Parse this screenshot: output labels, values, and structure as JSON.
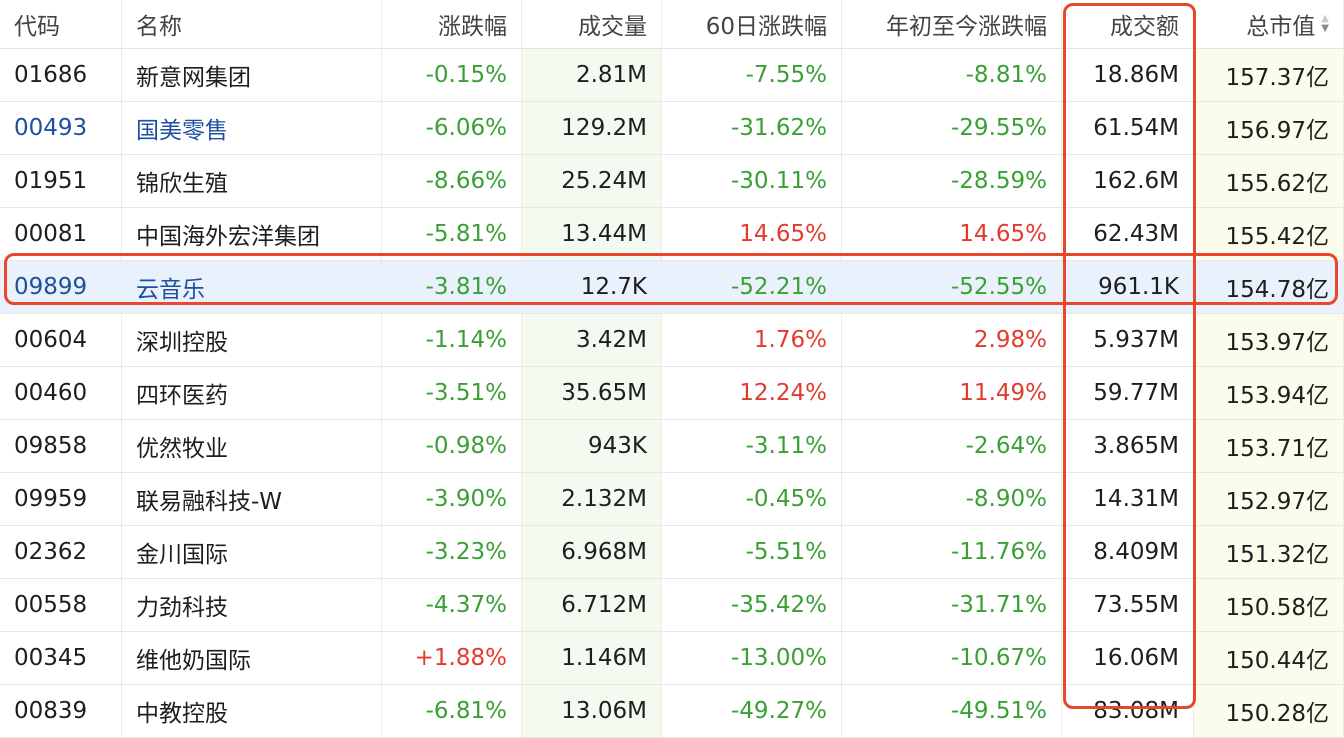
{
  "headers": {
    "code": "代码",
    "name": "名称",
    "change": "涨跌幅",
    "volume": "成交量",
    "change60": "60日涨跌幅",
    "ytd": "年初至今涨跌幅",
    "turnover": "成交额",
    "mktcap": "总市值"
  },
  "colors": {
    "up": "#e23b2e",
    "down": "#3a9f34",
    "link": "#1e4fa0",
    "highlight_box": "#e8472b"
  },
  "rows": [
    {
      "code": "01686",
      "name": "新意网集团",
      "change": "-0.15%",
      "volume": "2.81M",
      "change60": "-7.55%",
      "ytd": "-8.81%",
      "turnover": "18.86M",
      "mktcap": "157.37亿",
      "link": false
    },
    {
      "code": "00493",
      "name": "国美零售",
      "change": "-6.06%",
      "volume": "129.2M",
      "change60": "-31.62%",
      "ytd": "-29.55%",
      "turnover": "61.54M",
      "mktcap": "156.97亿",
      "link": true
    },
    {
      "code": "01951",
      "name": "锦欣生殖",
      "change": "-8.66%",
      "volume": "25.24M",
      "change60": "-30.11%",
      "ytd": "-28.59%",
      "turnover": "162.6M",
      "mktcap": "155.62亿",
      "link": false
    },
    {
      "code": "00081",
      "name": "中国海外宏洋集团",
      "change": "-5.81%",
      "volume": "13.44M",
      "change60": "14.65%",
      "ytd": "14.65%",
      "turnover": "62.43M",
      "mktcap": "155.42亿",
      "link": false
    },
    {
      "code": "09899",
      "name": "云音乐",
      "change": "-3.81%",
      "volume": "12.7K",
      "change60": "-52.21%",
      "ytd": "-52.55%",
      "turnover": "961.1K",
      "mktcap": "154.78亿",
      "link": true
    },
    {
      "code": "00604",
      "name": "深圳控股",
      "change": "-1.14%",
      "volume": "3.42M",
      "change60": "1.76%",
      "ytd": "2.98%",
      "turnover": "5.937M",
      "mktcap": "153.97亿",
      "link": false
    },
    {
      "code": "00460",
      "name": "四环医药",
      "change": "-3.51%",
      "volume": "35.65M",
      "change60": "12.24%",
      "ytd": "11.49%",
      "turnover": "59.77M",
      "mktcap": "153.94亿",
      "link": false
    },
    {
      "code": "09858",
      "name": "优然牧业",
      "change": "-0.98%",
      "volume": "943K",
      "change60": "-3.11%",
      "ytd": "-2.64%",
      "turnover": "3.865M",
      "mktcap": "153.71亿",
      "link": false
    },
    {
      "code": "09959",
      "name": "联易融科技-W",
      "change": "-3.90%",
      "volume": "2.132M",
      "change60": "-0.45%",
      "ytd": "-8.90%",
      "turnover": "14.31M",
      "mktcap": "152.97亿",
      "link": false
    },
    {
      "code": "02362",
      "name": "金川国际",
      "change": "-3.23%",
      "volume": "6.968M",
      "change60": "-5.51%",
      "ytd": "-11.76%",
      "turnover": "8.409M",
      "mktcap": "151.32亿",
      "link": false
    },
    {
      "code": "00558",
      "name": "力劲科技",
      "change": "-4.37%",
      "volume": "6.712M",
      "change60": "-35.42%",
      "ytd": "-31.71%",
      "turnover": "73.55M",
      "mktcap": "150.58亿",
      "link": false
    },
    {
      "code": "00345",
      "name": "维他奶国际",
      "change": "+1.88%",
      "volume": "1.146M",
      "change60": "-13.00%",
      "ytd": "-10.67%",
      "turnover": "16.06M",
      "mktcap": "150.44亿",
      "link": false
    },
    {
      "code": "00839",
      "name": "中教控股",
      "change": "-6.81%",
      "volume": "13.06M",
      "change60": "-49.27%",
      "ytd": "-49.51%",
      "turnover": "83.08M",
      "mktcap": "150.28亿",
      "link": false
    }
  ],
  "highlighted_code": "09899"
}
